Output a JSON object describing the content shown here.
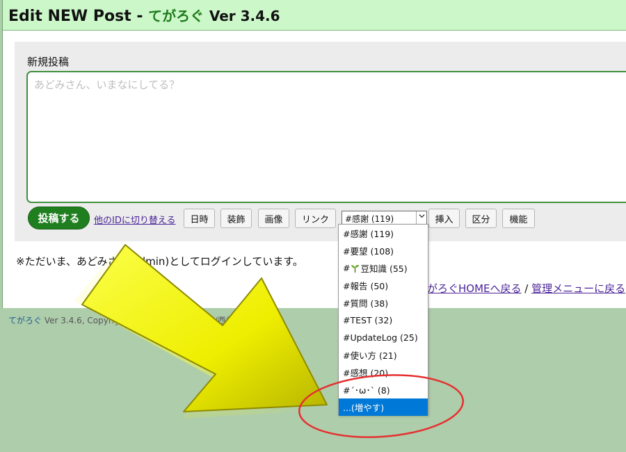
{
  "header": {
    "title": "Edit NEW Post - ",
    "brand": "てがろぐ",
    "version": "Ver 3.4.6"
  },
  "form": {
    "label": "新規投稿",
    "textarea_placeholder": "あどみさん、いまなにしてる？",
    "post_button": "投稿する",
    "switch_id_link": "他のIDに切り替える",
    "buttons": {
      "datetime": "日時",
      "decorate": "装飾",
      "image": "画像",
      "link": "リンク",
      "insert": "挿入",
      "division": "区分",
      "function": "機能"
    },
    "tag_select_value": "#感謝 (119)"
  },
  "dropdown": {
    "options": [
      "#感謝 (119)",
      "#要望 (108)",
      "#",
      "豆知識 (55)",
      "#報告 (50)",
      "#質問 (38)",
      "#TEST (32)",
      "#UpdateLog (25)",
      "#使い方 (21)",
      "#感想 (20)",
      "#´･ω･` (8)",
      "...(増やす)"
    ]
  },
  "login_status": "※ただいま、あどみさん(admin)としてログインしています。",
  "bottom_links": {
    "home": "てがろぐHOMEへ戻る",
    "separator": " / ",
    "admin": "管理メニューに戻る"
  },
  "footer": {
    "brand": "てがろぐ",
    "text": " Ver 3.4.6, Copyright © 2017-2021 にしし/西村文宏."
  },
  "colors": {
    "header_bg": "#ccf7c9",
    "accent_green": "#1f7f1f",
    "page_bg": "#aecdab",
    "arrow_yellow": "#f4f200",
    "highlight_red": "#e53030",
    "selected_blue": "#0078d7"
  },
  "icons": {
    "sprout": "sprout-icon",
    "dropdown_chevron": "chevron-down-icon"
  }
}
